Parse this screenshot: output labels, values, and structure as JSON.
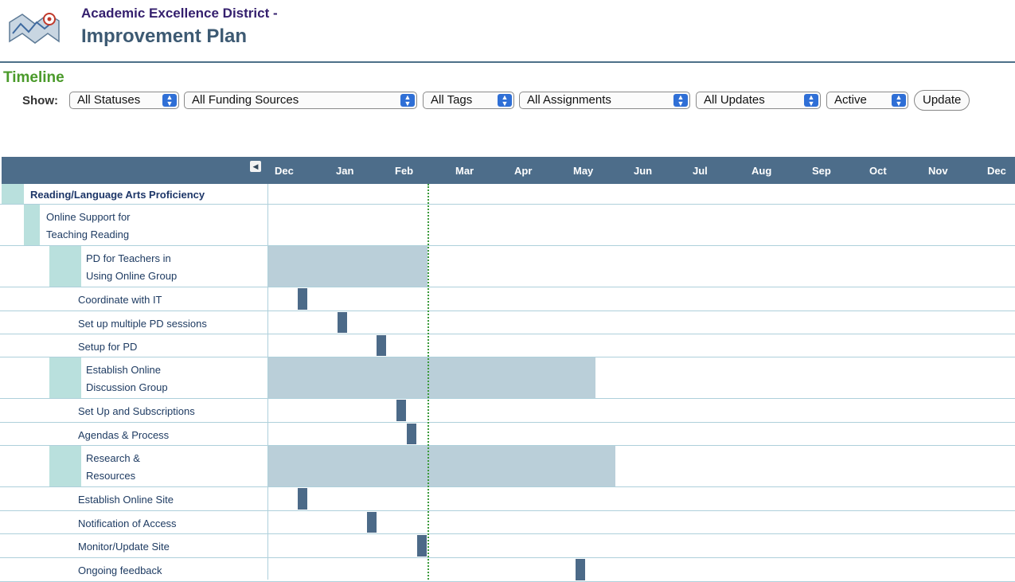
{
  "header": {
    "title_line1": "Academic Excellence District -",
    "title_line2": "Improvement Plan",
    "logo_icon": "map-logo-icon"
  },
  "section_title": "Timeline",
  "filters": {
    "show_label": "Show:",
    "status": "All Statuses",
    "funding": "All Funding Sources",
    "tags": "All Tags",
    "assignments": "All Assignments",
    "updates": "All Updates",
    "active": "Active",
    "update_button": "Update"
  },
  "timeline": {
    "months": [
      "Dec",
      "Jan",
      "Feb",
      "Mar",
      "Apr",
      "May",
      "Jun",
      "Jul",
      "Aug",
      "Sep",
      "Oct",
      "Nov",
      "Dec"
    ],
    "collapse_icon": "collapse-left-icon",
    "today_marker": "Feb",
    "rows": [
      {
        "label": "Reading/Language Arts Proficiency",
        "level": 0
      },
      {
        "label": "Online Support for\nTeaching Reading",
        "level": 1
      },
      {
        "label": "PD for Teachers in\nUsing Online Group",
        "level": 2,
        "bar_type": "span",
        "start": "Dec",
        "end": "Feb"
      },
      {
        "label": "Coordinate with IT",
        "level": 3,
        "bar_type": "task",
        "start": "Dec"
      },
      {
        "label": "Set up multiple PD sessions",
        "level": 3,
        "bar_type": "task",
        "start": "Jan"
      },
      {
        "label": "Setup for PD",
        "level": 3,
        "bar_type": "task",
        "start": "Feb"
      },
      {
        "label": "Establish Online\nDiscussion Group",
        "level": 2,
        "bar_type": "span",
        "start": "Dec",
        "end": "May"
      },
      {
        "label": "Set Up and Subscriptions",
        "level": 3,
        "bar_type": "task",
        "start": "Feb"
      },
      {
        "label": "Agendas & Process",
        "level": 3,
        "bar_type": "task",
        "start": "Feb"
      },
      {
        "label": "Research &\nResources",
        "level": 2,
        "bar_type": "span",
        "start": "Dec",
        "end": "Jun"
      },
      {
        "label": "Establish Online Site",
        "level": 3,
        "bar_type": "task",
        "start": "Dec"
      },
      {
        "label": "Notification of Access",
        "level": 3,
        "bar_type": "task",
        "start": "Jan"
      },
      {
        "label": "Monitor/Update Site",
        "level": 3,
        "bar_type": "task",
        "start": "Feb"
      },
      {
        "label": "Ongoing feedback",
        "level": 3,
        "bar_type": "task",
        "start": "May"
      }
    ]
  },
  "colors": {
    "header_bar": "#4d6d8a",
    "span_bar": "#bacfd9",
    "task_bar": "#4c6a88",
    "today_line": "#3b9a3b",
    "section_title": "#4a9a2a",
    "indent": "#b9e0dd"
  }
}
